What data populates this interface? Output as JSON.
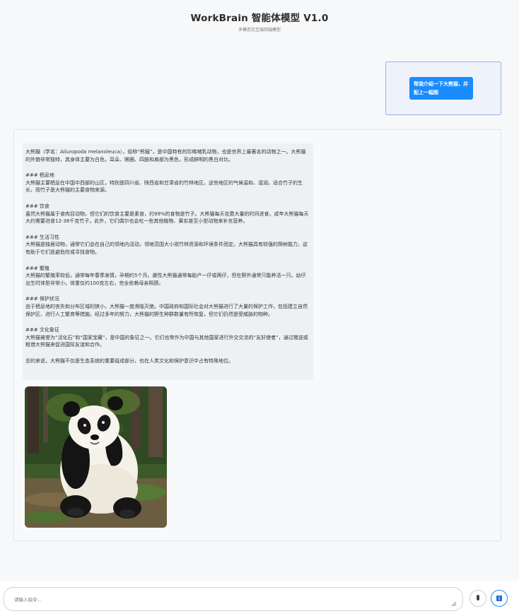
{
  "header": {
    "title": "WorkBrain 智能体模型 V1.0",
    "subtitle": "多模态交互端到端模型"
  },
  "user_message": {
    "text": "帮我介绍一下大熊猫，并配上一幅图"
  },
  "bot_message": {
    "paragraphs": [
      {
        "heading": "",
        "body": "大熊猫（学名：Ailuropoda melanoleuca），俗称“熊猫”，是中国特有的珍稀哺乳动物，也是世界上最著名的动物之一。大熊猫的外貌非常独特，其身体主要为白色，耳朵、眼圈、四肢和肩部为黑色，形成鲜明的黑白对比。"
      },
      {
        "heading": "### 栖息地",
        "body": "大熊猫主要栖息在中国中西部的山区，特别是四川省、陕西省和甘肃省的竹林地区。这些地区的气候温和、湿润，适合竹子的生长，而竹子是大熊猫的主要食物来源。"
      },
      {
        "heading": "### 饮食",
        "body": "虽然大熊猫属于食肉目动物，但它们的饮食主要是素食，约99%的食物是竹子。大熊猫每天花费大量的时间进食，成年大熊猫每天大约需要进食12-38千克竹子。此外，它们偶尔也会吃一些其他植物、果实甚至小型动物来补充营养。"
      },
      {
        "heading": "### 生活习性",
        "body": "大熊猫是独居动物，通常它们会在自己的领地内活动，领地范围大小视竹林资源和环境条件而定。大熊猫具有较强的爬树能力，这有助于它们逃避危险或寻找食物。"
      },
      {
        "heading": "### 繁殖",
        "body": "大熊猫的繁殖率较低，通常每年春季发情，孕期约5个月。雌性大熊猫通常每胎产一仔或两仔，但在野外通常只能养活一只。幼仔出生时体型非常小，体重仅约100克左右，完全依赖母亲照顾。"
      },
      {
        "heading": "### 保护状况",
        "body": "由于栖息地的丧失和分布区域的狭小，大熊猫一度濒临灭绝。中国政府和国际社会对大熊猫进行了大量的保护工作，包括建立自然保护区、进行人工繁育等措施。经过多年的努力，大熊猫的野生种群数量有所恢复，但它们仍然是受威胁的物种。"
      },
      {
        "heading": "### 文化象征",
        "body": "大熊猫被誉为“活化石”和“国家宝藏”，是中国的象征之一。它们也常作为中国与其他国家进行外交交流的“友好使者”，通过赠送或租借大熊猫来促进国际友谊和合作。"
      },
      {
        "heading": "",
        "body": "总的来说，大熊猫不仅是生态系统的重要组成部分，也在人类文化和保护意识中占有特殊地位。"
      }
    ],
    "image_subject": "giant panda sitting in bamboo forest"
  },
  "input": {
    "placeholder": "请输入指令..."
  },
  "icons": {
    "mic": "microphone-icon",
    "send": "send-icon"
  },
  "colors": {
    "accent": "#1a8cff",
    "user_card_bg": "#eef2fb",
    "user_card_border": "#9fb1e6"
  }
}
